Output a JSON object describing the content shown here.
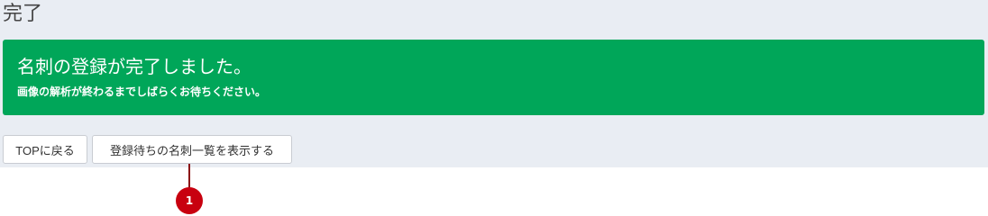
{
  "page": {
    "title": "完了"
  },
  "alert": {
    "title": "名刺の登録が完了しました。",
    "message": "画像の解析が終わるまでしばらくお待ちください。",
    "color": "#00a659"
  },
  "actions": {
    "top_label": "TOPに戻る",
    "list_label": "登録待ちの名刺一覧を表示する"
  },
  "annotation": {
    "number": "1",
    "color": "#c8000f"
  }
}
